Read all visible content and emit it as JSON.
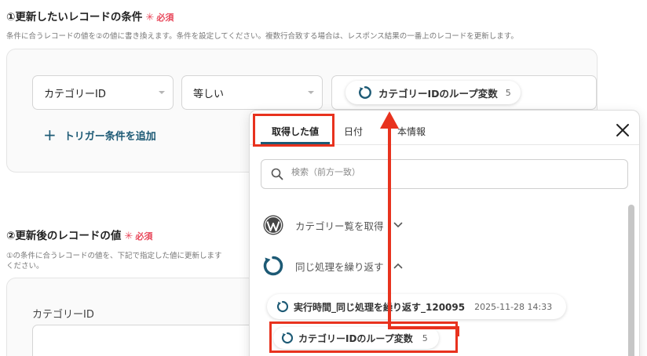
{
  "section1": {
    "title": "①更新したいレコードの条件",
    "required_mark": "✳",
    "required_label": "必須",
    "description": "条件に合うレコードの値を②の値に書き換えます。条件を設定してください。複数行合致する場合は、レスポンス結果の一番上のレコードを更新します。",
    "field_select": "カテゴリーID",
    "operator_select": "等しい",
    "value_pill": {
      "label": "カテゴリーIDのループ変数",
      "count": "5"
    },
    "add_trigger": "トリガー条件を追加"
  },
  "section2": {
    "title": "②更新後のレコードの値",
    "required_mark": "✳",
    "required_label": "必須",
    "description_line1": "①の条件に合うレコードの値を、下記で指定した値に更新します",
    "description_line2": "ください。",
    "field_label": "カテゴリーID"
  },
  "dialog": {
    "tabs": [
      {
        "label": "取得した値",
        "active": true
      },
      {
        "label": "日付",
        "active": false
      },
      {
        "label": "本情報",
        "active": false
      }
    ],
    "search_placeholder": "検索（前方一致）",
    "groups": [
      {
        "label": "カテゴリー覧を取得",
        "icon": "wordpress-icon",
        "expanded": false
      },
      {
        "label": "同じ処理を繰り返す",
        "icon": "loop-icon",
        "expanded": true
      }
    ],
    "items": [
      {
        "label": "実行時間_同じ処理を繰り返す_120095",
        "meta": "2025-11-28 14:33"
      },
      {
        "label": "カテゴリーIDのループ変数",
        "meta": "5"
      }
    ]
  },
  "colors": {
    "accent": "#1d5a75",
    "required": "#e8475a",
    "highlight": "#e8321e"
  }
}
